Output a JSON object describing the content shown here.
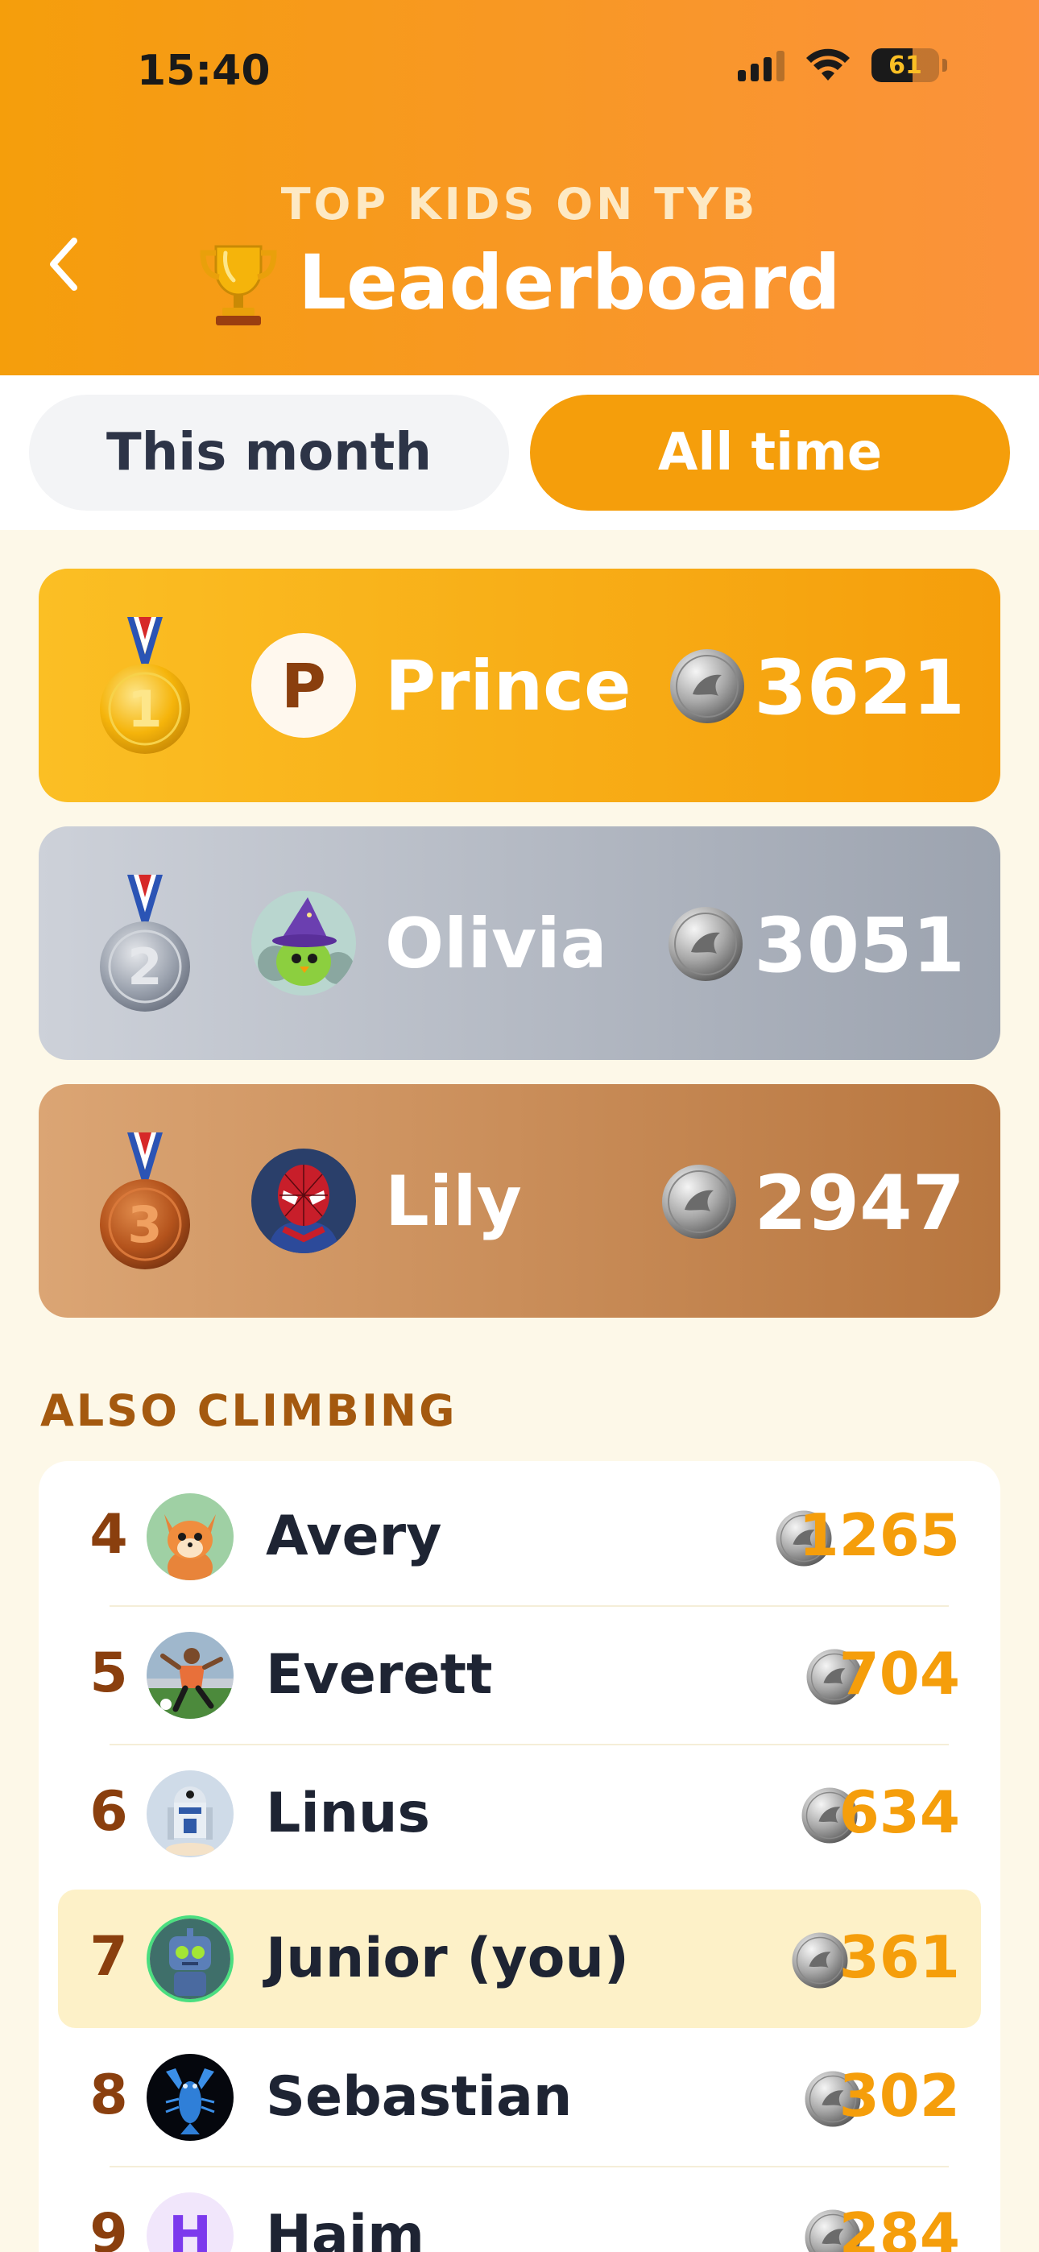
{
  "status_bar": {
    "time": "15:40",
    "battery": "61",
    "battery_level": 0.61
  },
  "header": {
    "subtitle": "TOP KIDS ON TYB",
    "title": "Leaderboard",
    "icons": {
      "back": "chevron-left-icon",
      "trophy": "trophy-icon"
    }
  },
  "tabs": {
    "this_month": "This month",
    "all_time": "All time",
    "active": "all_time"
  },
  "podium": [
    {
      "rank": "1",
      "name": "Prince",
      "score": "3621",
      "avatar_letter": "P",
      "medal": "gold-medal-icon"
    },
    {
      "rank": "2",
      "name": "Olivia",
      "score": "3051",
      "avatar": "wizard-bird-avatar",
      "medal": "silver-medal-icon"
    },
    {
      "rank": "3",
      "name": "Lily",
      "score": "2947",
      "avatar": "spiderman-avatar",
      "medal": "bronze-medal-icon"
    }
  ],
  "section_label": "ALSO CLIMBING",
  "list": [
    {
      "rank": "4",
      "name": "Avery",
      "score": "1265",
      "avatar": "fox-avatar"
    },
    {
      "rank": "5",
      "name": "Everett",
      "score": "704",
      "avatar": "soccer-player-avatar"
    },
    {
      "rank": "6",
      "name": "Linus",
      "score": "634",
      "avatar": "robot-droid-avatar"
    },
    {
      "rank": "7",
      "name": "Junior (you)",
      "score": "361",
      "avatar": "robot-avatar",
      "highlight": true
    },
    {
      "rank": "8",
      "name": "Sebastian",
      "score": "302",
      "avatar": "lobster-avatar"
    },
    {
      "rank": "9",
      "name": "Haim",
      "score": "284",
      "avatar_letter": "H"
    }
  ],
  "colors": {
    "header_gradient_start": "#f59e0b",
    "header_gradient_end": "#fb923c",
    "accent": "#f59e0b",
    "rank_text": "#8a3f0e",
    "section_label": "#a4590f",
    "highlight_row": "#fdf1c8"
  }
}
